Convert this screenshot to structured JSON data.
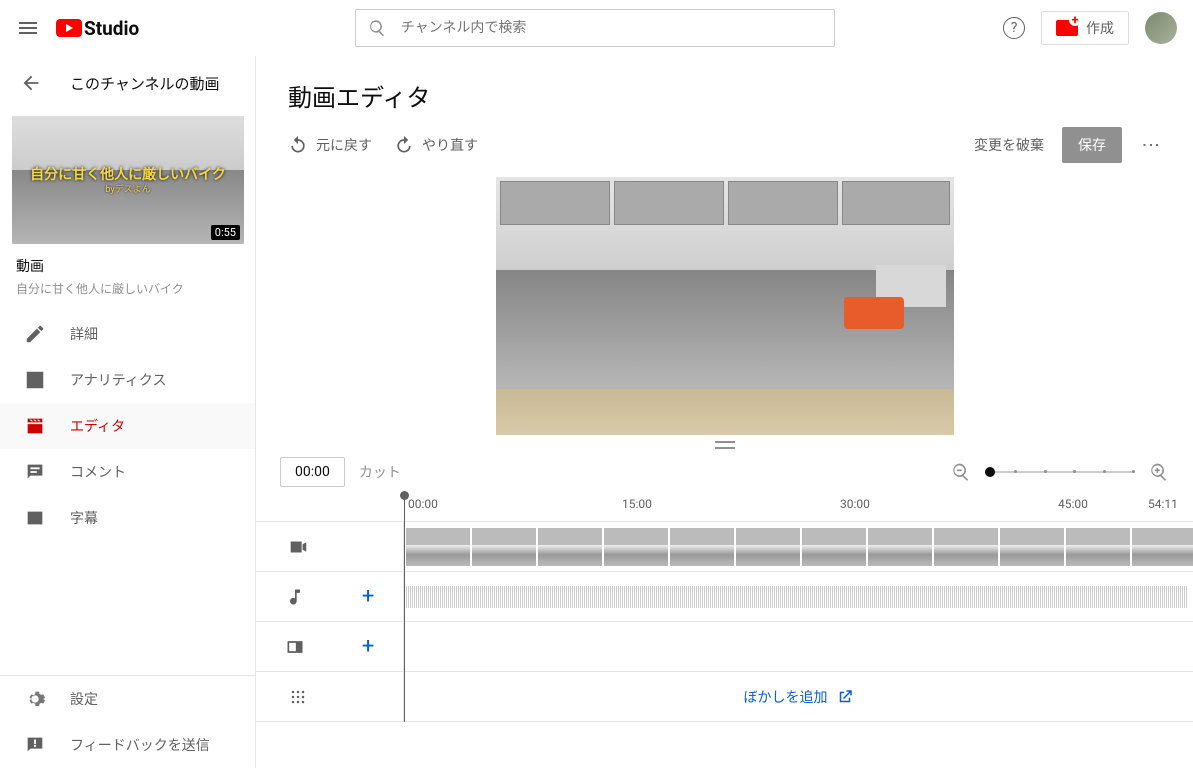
{
  "header": {
    "studio": "Studio",
    "search_placeholder": "チャンネル内で検索",
    "create": "作成"
  },
  "sidebar": {
    "back_label": "このチャンネルの動画",
    "thumb_title": "自分に甘く他人に厳しいバイク",
    "thumb_sub": "byデスよん",
    "duration": "0:55",
    "video_word": "動画",
    "video_title": "自分に甘く他人に厳しいバイク",
    "nav": {
      "details": "詳細",
      "analytics": "アナリティクス",
      "editor": "エディタ",
      "comments": "コメント",
      "subtitles": "字幕",
      "settings": "設定",
      "feedback": "フィードバックを送信"
    }
  },
  "main": {
    "title": "動画エディタ",
    "undo": "元に戻す",
    "redo": "やり直す",
    "discard": "変更を破棄",
    "save": "保存",
    "timecode": "00:00",
    "cut": "カット",
    "ruler": {
      "m0": "00:00",
      "m15": "15:00",
      "m30": "30:00",
      "m45": "45:00",
      "end": "54:11"
    },
    "blur": "ぼかしを追加"
  }
}
